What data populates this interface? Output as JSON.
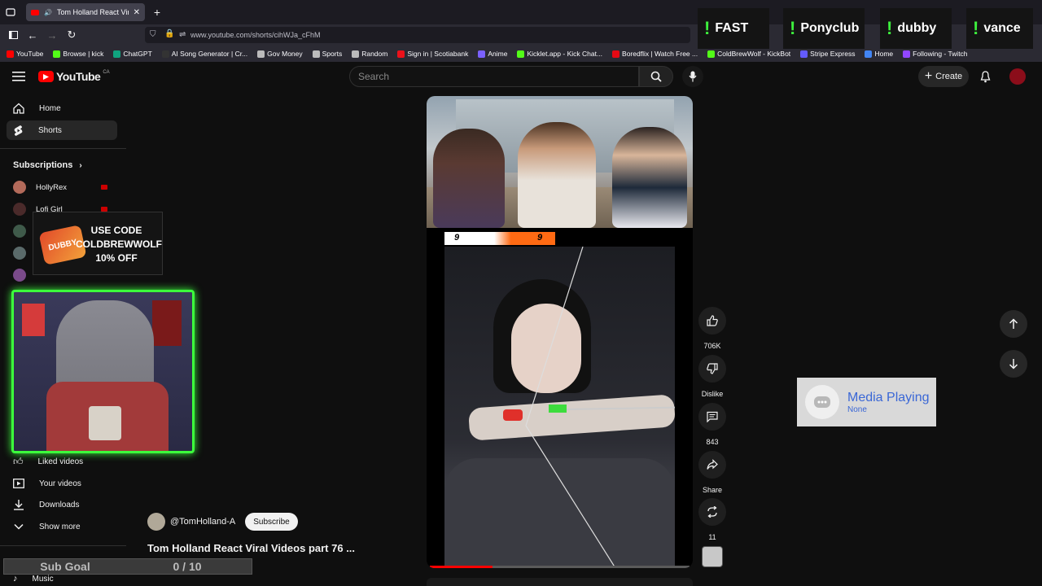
{
  "browser": {
    "tab_title": "Tom Holland React Viral Vi",
    "url": "www.youtube.com/shorts/cihWJa_cFhM",
    "bookmarks": [
      "YouTube",
      "Browse | kick",
      "ChatGPT",
      "AI Song Generator | Cr...",
      "Gov Money",
      "Sports",
      "Random",
      "Sign in | Scotiabank",
      "Anime",
      "Kicklet.app - Kick Chat...",
      "Boredflix | Watch Free ...",
      "ColdBrewWolf - KickBot",
      "Stripe Express",
      "Home",
      "Following - Twitch"
    ],
    "bookmark_colors": [
      "#ff0000",
      "#53fc18",
      "#10a37f",
      "#333333",
      "#bbbbbb",
      "#bbbbbb",
      "#bbbbbb",
      "#ec111a",
      "#7b61ff",
      "#53fc18",
      "#e50914",
      "#53fc18",
      "#635bff",
      "#4285f4",
      "#9146ff"
    ]
  },
  "overlay_tags": [
    "FAST",
    "Ponyclub",
    "dubby",
    "vance"
  ],
  "header": {
    "logo_text": "YouTube",
    "country": "CA",
    "search_placeholder": "Search",
    "create_label": "Create"
  },
  "sidebar": {
    "items": [
      {
        "label": "Home",
        "icon": "home-icon"
      },
      {
        "label": "Shorts",
        "icon": "shorts-icon"
      }
    ],
    "subscriptions_label": "Subscriptions",
    "subscriptions": [
      "HollyRex",
      "Lofi Girl"
    ],
    "bottom_items": [
      {
        "label": "Liked videos",
        "icon": "thumbs-up-icon"
      },
      {
        "label": "Your videos",
        "icon": "video-icon"
      },
      {
        "label": "Downloads",
        "icon": "download-icon"
      },
      {
        "label": "Show more",
        "icon": "chevron-down-icon"
      }
    ],
    "music_label": "Music"
  },
  "promo": {
    "brand": "DUBBY",
    "text": "USE CODE COLDBREWWOLF 10% OFF"
  },
  "short": {
    "score_left": "9",
    "score_right": "9",
    "channel": "@TomHolland-A",
    "subscribe_label": "Subscribe",
    "title": "Tom Holland React Viral Videos part 76 ...",
    "progress": 0.24
  },
  "actions": {
    "likes": "706K",
    "dislike_label": "Dislike",
    "comments": "843",
    "share_label": "Share",
    "remix": "11"
  },
  "media_widget": {
    "title": "Media Playing",
    "subtitle": "None"
  },
  "sub_goal": {
    "label": "Sub Goal",
    "value": "0 / 10"
  },
  "colors": {
    "accent": "#ff0000",
    "cam_border": "#3cff3c",
    "overlay_bang": "#3df03d"
  }
}
